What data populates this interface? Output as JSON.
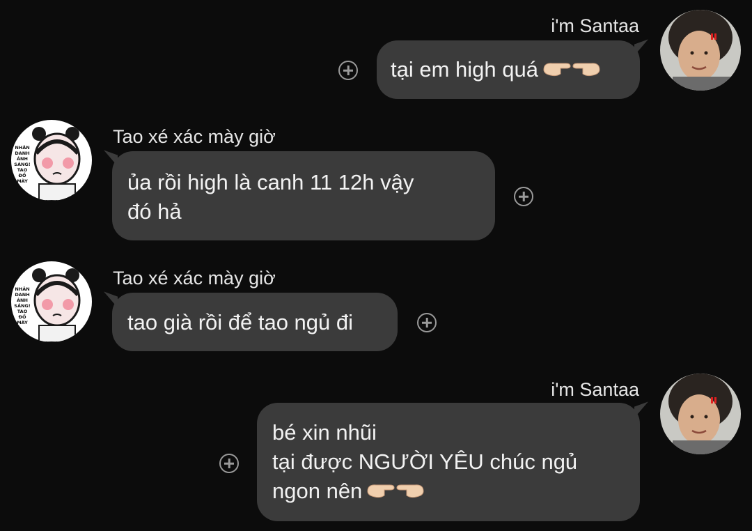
{
  "messages": [
    {
      "sender": "i'm Santaa",
      "direction": "outgoing",
      "lines": [
        "tại em high quá"
      ],
      "emoji": "pointing-hands-icon"
    },
    {
      "sender": "Tao xé xác mày giờ",
      "direction": "incoming",
      "lines": [
        "ủa rồi high là canh 11 12h vậy",
        "đó hả"
      ]
    },
    {
      "sender": "Tao xé xác mày giờ",
      "direction": "incoming",
      "lines": [
        "tao già rồi để tao ngủ đi"
      ]
    },
    {
      "sender": "i'm Santaa",
      "direction": "outgoing",
      "lines": [
        "bé xin nhũi",
        "tại được NGƯỜI YÊU chúc ngủ",
        "ngon nên"
      ],
      "emoji": "pointing-hands-icon"
    }
  ],
  "avatars": {
    "incoming_sticker_text": [
      "NHÂN",
      "DANH",
      "ÁNH",
      "SÁNG!",
      "TAO ĐỒ",
      "MÀY"
    ]
  },
  "colors": {
    "background": "#0c0c0c",
    "bubble": "#3b3b3b",
    "text": "#f2f2f2",
    "react_icon": "#9a9a9a"
  }
}
